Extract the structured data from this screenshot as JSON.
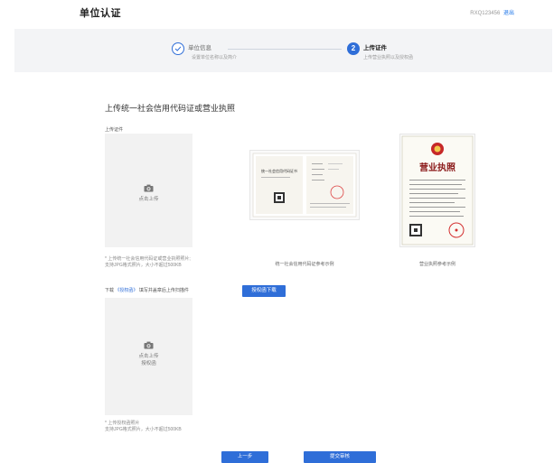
{
  "header": {
    "title": "单位认证",
    "account": "RXQ123456",
    "logout": "退出"
  },
  "steps": [
    {
      "number": "1",
      "title": "单位信息",
      "subtitle": "设置单位名称以及简介"
    },
    {
      "number": "2",
      "title": "上传证件",
      "subtitle": "上传营业执照以及授权函"
    }
  ],
  "section": {
    "title": "上传统一社会信用代码证或营业执照",
    "upload_label": "上传证件"
  },
  "upload1": {
    "text": "点击上传",
    "hint1": "* 上传统一社会信用代码证或营业执照照片;",
    "hint2": "支持JPG格式照片，大小不超过500KB"
  },
  "samples": [
    {
      "caption": "统一社会信用代码证参考示例",
      "doc_title": "统一社会信用代码证书"
    },
    {
      "caption": "营业执照参考示例",
      "doc_title": "营业执照"
    }
  ],
  "download": {
    "prefix": "下载",
    "link": "《授权函》",
    "suffix": "填写并盖章后上传扫描件",
    "button": "授权函下载"
  },
  "upload2": {
    "line1": "点击上传",
    "line2": "授权函",
    "hint1": "* 上传授权函照片",
    "hint2": "支持JPG格式照片，大小不超过500KB"
  },
  "footer": {
    "prev": "上一步",
    "submit": "提交审核"
  },
  "colors": {
    "accent": "#2f6ed8",
    "panel": "#f3f4f6"
  }
}
